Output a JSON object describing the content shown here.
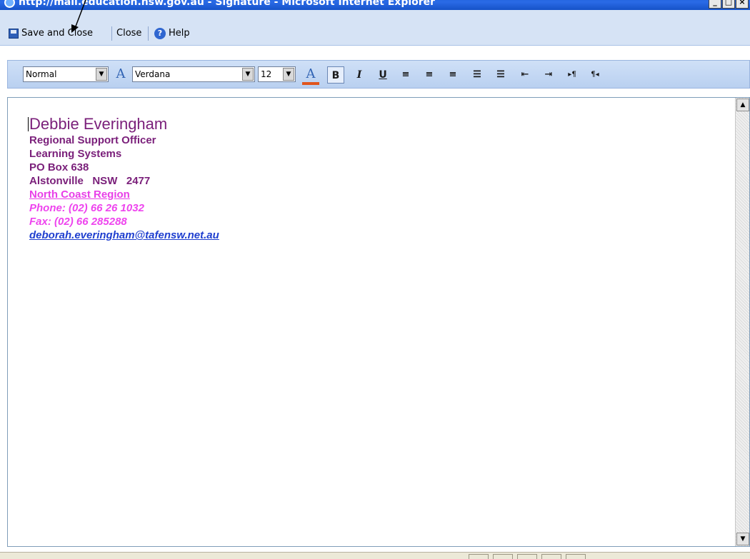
{
  "window": {
    "title": "http://mail.education.nsw.gov.au - Signature - Microsoft Internet Explorer",
    "controls": [
      "_",
      "□",
      "×"
    ]
  },
  "toolbar": {
    "save_close_label": "Save and Close",
    "close_label": "Close",
    "help_label": "Help"
  },
  "format": {
    "style_value": "Normal",
    "font_value": "Verdana",
    "size_value": "12",
    "bold_label": "B",
    "italic_label": "I",
    "underline_label": "U",
    "font_icon": "font-icon",
    "color_icon": "font-color-icon",
    "highlight_color": "#e0551e"
  },
  "signature": {
    "name": "Debbie Everingham",
    "title": "Regional Support Officer",
    "department": "Learning Systems",
    "address1": "PO Box 638",
    "address2": "Alstonville   NSW   2477",
    "region": "North Coast Region",
    "phone": "Phone: (02) 66 26 1032",
    "fax": "Fax: (02) 66 285288",
    "email": "deborah.everingham@tafensw.net.au"
  },
  "colors": {
    "name": "#7a1f7a",
    "link": "#e83fe8",
    "email": "#1f3fcf"
  }
}
